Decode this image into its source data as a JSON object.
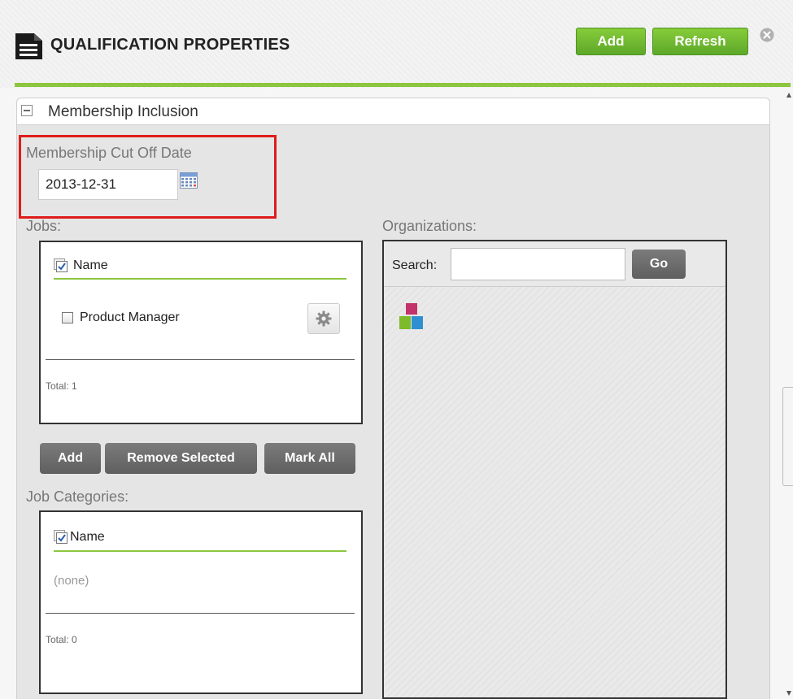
{
  "header": {
    "title": "QUALIFICATION PROPERTIES",
    "add_label": "Add",
    "refresh_label": "Refresh",
    "accent_color": "#8cc63f"
  },
  "section": {
    "title": "Membership Inclusion"
  },
  "cutoff": {
    "label": "Membership Cut Off Date",
    "value": "2013-12-31"
  },
  "jobs": {
    "label": "Jobs:",
    "column_header": "Name",
    "rows": [
      {
        "label": "Product Manager"
      }
    ],
    "total": "Total: 1"
  },
  "job_actions": {
    "add_label": "Add",
    "remove_label": "Remove Selected",
    "mark_all_label": "Mark All"
  },
  "job_categories": {
    "label": "Job Categories:",
    "column_header": "Name",
    "empty_text": "(none)",
    "total": "Total: 0"
  },
  "organizations": {
    "label": "Organizations:",
    "search_label": "Search:",
    "search_value": "",
    "go_label": "Go"
  }
}
